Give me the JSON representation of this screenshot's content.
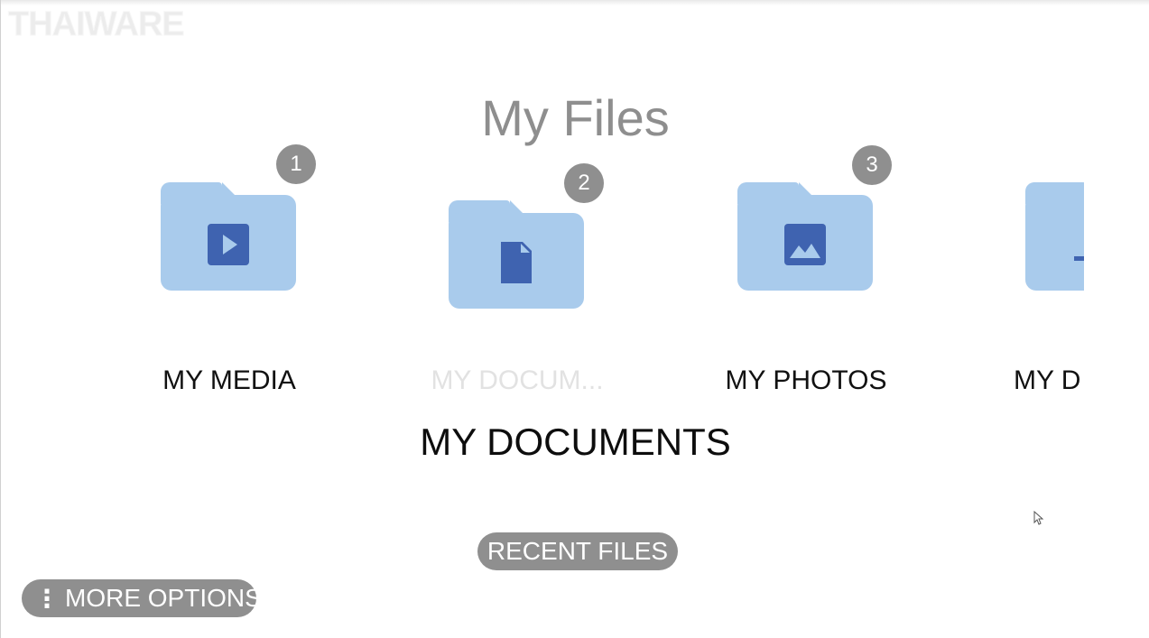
{
  "watermark": "THAIWARE",
  "title": "My Files",
  "folders": [
    {
      "label": "MY MEDIA",
      "badge": "1",
      "icon": "play-icon"
    },
    {
      "label": "MY DOCUM...",
      "badge": "2",
      "icon": "document-icon"
    },
    {
      "label": "MY PHOTOS",
      "badge": "3",
      "icon": "image-icon"
    },
    {
      "label": "MY D",
      "icon": "download-icon"
    }
  ],
  "selected_folder_name": "MY DOCUMENTS",
  "buttons": {
    "recent_files": "RECENT FILES",
    "more_options": "MORE OPTIONS",
    "more_options_glyph": "⋮"
  },
  "colors": {
    "folder": "#a9cbec",
    "folder_glyph": "#3f63b0",
    "badge": "#8f8f8f",
    "title": "#8e8e8e"
  }
}
